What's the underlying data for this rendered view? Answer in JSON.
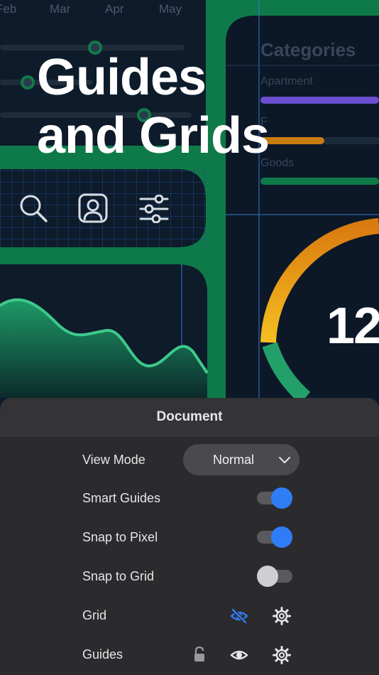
{
  "background": {
    "months": [
      "Feb",
      "Mar",
      "Apr",
      "May"
    ],
    "categories_title": "Categories",
    "category_labels": [
      "Apartment",
      "F",
      "Goods"
    ],
    "big_number": "12",
    "colors": {
      "green": "#0d7a47",
      "navy": "#0b1a2a",
      "grid_line": "#2a5aa8",
      "gauge_orange": "#f0a020",
      "wave": "#3ec98a"
    }
  },
  "headline": {
    "line1": "Guides",
    "line2": "and Grids"
  },
  "toolbar_icons": [
    "search-icon",
    "user-portrait-icon",
    "sliders-icon"
  ],
  "sheet": {
    "title": "Document",
    "rows": {
      "view_mode": {
        "label": "View Mode",
        "value": "Normal"
      },
      "smart_guides": {
        "label": "Smart Guides",
        "on": true
      },
      "snap_pixel": {
        "label": "Snap to Pixel",
        "on": true
      },
      "snap_grid": {
        "label": "Snap to Grid",
        "on": false
      },
      "grid": {
        "label": "Grid",
        "icons": [
          "eye-slash-icon",
          "gear-icon"
        ]
      },
      "guides": {
        "label": "Guides",
        "icons": [
          "lock-icon",
          "eye-icon",
          "gear-icon"
        ]
      }
    },
    "accent_color": "#2f7df6"
  }
}
